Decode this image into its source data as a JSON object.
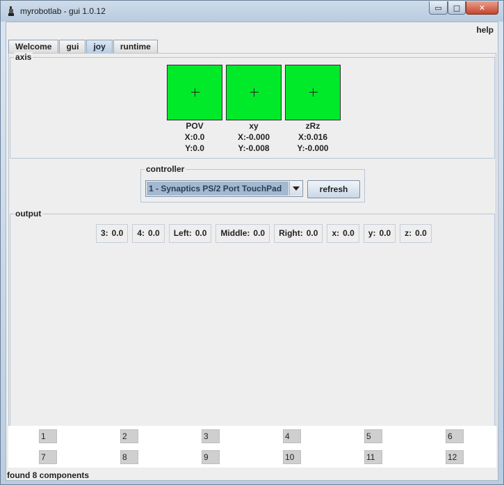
{
  "window": {
    "title": "myrobotlab - gui 1.0.12",
    "controls": {
      "minimize": "▭",
      "maximize": "□",
      "close": "✕"
    }
  },
  "menubar": {
    "help": "help"
  },
  "tabs": [
    {
      "label": "Welcome",
      "active": false
    },
    {
      "label": "gui",
      "active": false
    },
    {
      "label": "joy",
      "active": true
    },
    {
      "label": "runtime",
      "active": false
    }
  ],
  "axis": {
    "title": "axis",
    "panels": [
      {
        "name": "POV",
        "x": "X:0.0",
        "y": "Y:0.0"
      },
      {
        "name": "xy",
        "x": "X:-0.000",
        "y": "Y:-0.008"
      },
      {
        "name": "zRz",
        "x": "X:0.016",
        "y": "Y:-0.000"
      }
    ],
    "color": "#00ea2a"
  },
  "controller": {
    "title": "controller",
    "selected": "1 - Synaptics PS/2 Port TouchPad",
    "refresh_label": "refresh"
  },
  "output": {
    "title": "output",
    "items": [
      {
        "label": "3:",
        "value": "0.0"
      },
      {
        "label": "4:",
        "value": "0.0"
      },
      {
        "label": "Left:",
        "value": "0.0"
      },
      {
        "label": "Middle:",
        "value": "0.0"
      },
      {
        "label": "Right:",
        "value": "0.0"
      },
      {
        "label": "x:",
        "value": "0.0"
      },
      {
        "label": "y:",
        "value": "0.0"
      },
      {
        "label": "z:",
        "value": "0.0"
      }
    ]
  },
  "buttons": [
    "1",
    "2",
    "3",
    "4",
    "5",
    "6",
    "7",
    "8",
    "9",
    "10",
    "11",
    "12"
  ],
  "status": "found 8 components"
}
